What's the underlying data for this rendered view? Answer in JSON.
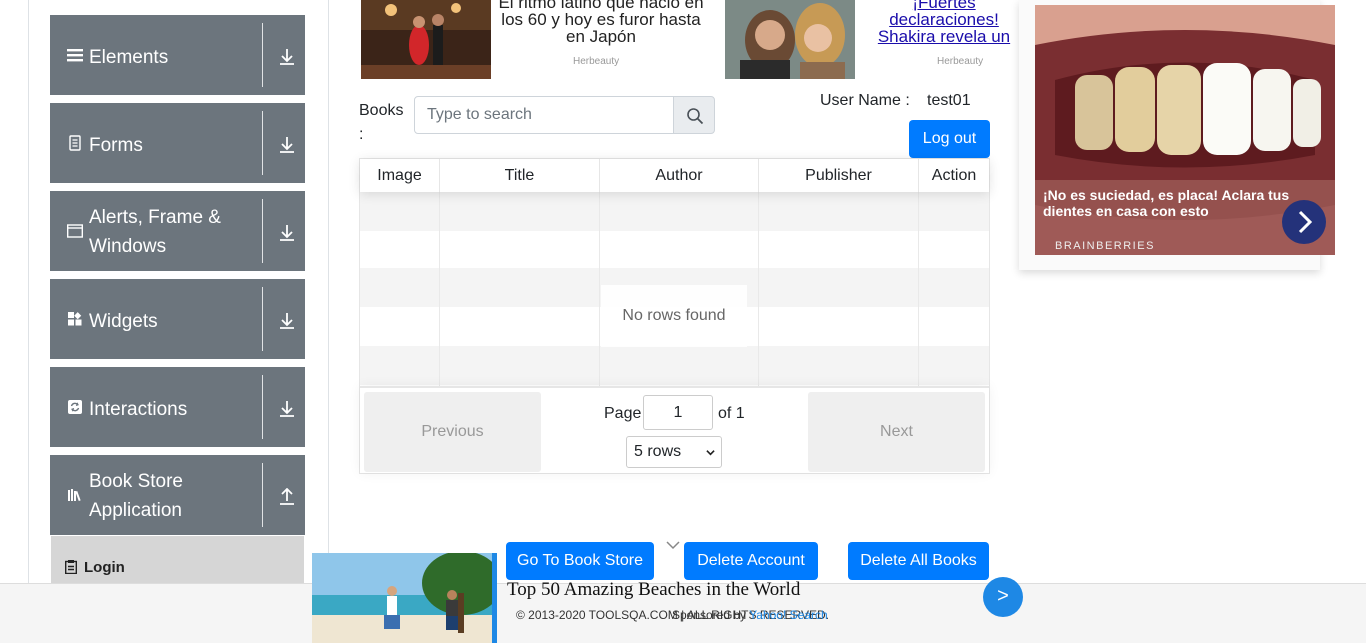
{
  "sidebar": {
    "groups": [
      {
        "label": "Elements",
        "icon": "hamburger-icon",
        "arrow": "download-arrow-icon"
      },
      {
        "label": "Forms",
        "icon": "document-icon",
        "arrow": "download-arrow-icon"
      },
      {
        "label": "Alerts, Frame & Windows",
        "icon": "window-icon",
        "arrow": "download-arrow-icon"
      },
      {
        "label": "Widgets",
        "icon": "widgets-icon",
        "arrow": "download-arrow-icon"
      },
      {
        "label": "Interactions",
        "icon": "refresh-icon",
        "arrow": "download-arrow-icon"
      },
      {
        "label": "Book Store Application",
        "icon": "books-icon",
        "arrow": "upload-arrow-icon"
      }
    ],
    "active_item": {
      "label": "Login",
      "icon": "clipboard-icon"
    },
    "colors": {
      "group_bg": "#6c757d",
      "item_bg": "#d6d6d6"
    }
  },
  "top_ads": [
    {
      "text": "El ritmo latino que nació en los 60 y hoy es furor hasta en Japón",
      "source": "Herbeauty"
    },
    {
      "text": "¡Fuertes declaraciones! Shakira revela un íntimo secreto de su e",
      "source": "Herbeauty"
    }
  ],
  "search": {
    "label": "Books :",
    "placeholder": "Type to search",
    "button_icon": "magnifier-icon"
  },
  "user": {
    "label": "User Name :",
    "value": "test01",
    "logout_label": "Log out"
  },
  "table": {
    "columns": [
      "Image",
      "Title",
      "Author",
      "Publisher",
      "Action"
    ],
    "empty_message": "No rows found",
    "pagination": {
      "previous_label": "Previous",
      "next_label": "Next",
      "page_label": "Page",
      "current_page": "1",
      "of_label": "of 1",
      "rows_option": "5 rows"
    }
  },
  "right_ad": {
    "caption": "¡No es suciedad, es placa! Aclara tus dientes en casa con esto",
    "brand": "BRAINBERRIES",
    "next_icon": "chevron-right-icon"
  },
  "actions": {
    "go_to_store": "Go To Book Store",
    "delete_account": "Delete Account",
    "delete_all_books": "Delete All Books"
  },
  "footer": {
    "copyright": "© 2013-2020 TOOLSQA.COM | ALL RIGHTS RESERVED.",
    "sponsored_prefix": "Sponsored by ",
    "sponsored_brand": "Yahoo! Search"
  },
  "bottom_ad": {
    "title": "Top 50 Amazing Beaches in the World",
    "next_label": ">"
  },
  "colors": {
    "primary": "#007bff",
    "ad_blue": "#1e88e5"
  }
}
